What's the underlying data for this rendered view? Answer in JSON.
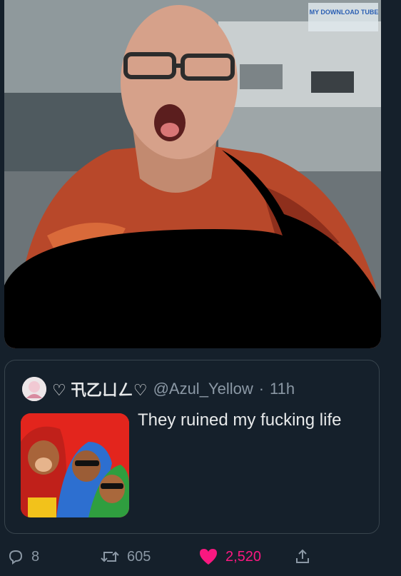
{
  "media": {
    "watermark_text": "MY DOWNLOAD TUBE"
  },
  "quoted_tweet": {
    "display_name": "♡ 卂乙ㄩㄥ♡",
    "handle": "@Azul_Yellow",
    "separator": "·",
    "time": "11h",
    "text": "They ruined my fucking life"
  },
  "actions": {
    "replies": "8",
    "retweets": "605",
    "likes": "2,520",
    "liked": true
  },
  "colors": {
    "background": "#15202b",
    "border": "#38444d",
    "secondary_text": "#8b98a5",
    "like_pink": "#f91880"
  }
}
